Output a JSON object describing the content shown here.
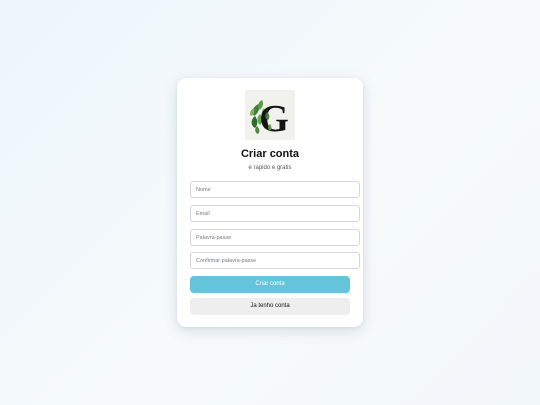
{
  "signup": {
    "title": "Criar conta",
    "subtitle": "e rapido e gratis",
    "fields": {
      "name_placeholder": "Nome",
      "email_placeholder": "Email",
      "password_placeholder": "Palavra-passe",
      "confirm_password_placeholder": "Confirmar palavra-passe"
    },
    "create_button_label": "Criar conta",
    "have_account_button_label": "Ja tenho conta"
  },
  "logo": {
    "icon": "leaf-letter-g-logo",
    "letter": "G"
  },
  "colors": {
    "primary_button": "#66c4da",
    "secondary_button": "#eeeeee",
    "card": "#ffffff",
    "background": "#eef6fb"
  }
}
